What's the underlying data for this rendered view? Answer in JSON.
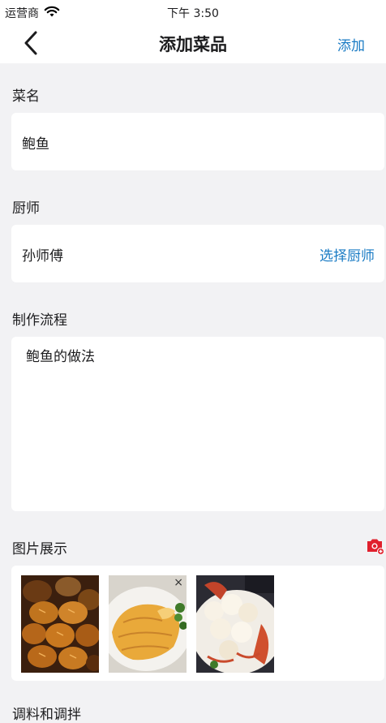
{
  "status_bar": {
    "carrier": "运营商",
    "time": "下午 3:50"
  },
  "nav": {
    "title": "添加菜品",
    "action": "添加"
  },
  "dish_name": {
    "label": "菜名",
    "value": "鲍鱼"
  },
  "chef": {
    "label": "厨师",
    "value": "孙师傅",
    "action": "选择厨师"
  },
  "process": {
    "label": "制作流程",
    "value": "鲍鱼的做法"
  },
  "gallery": {
    "label": "图片展示",
    "remove_symbol": "×",
    "photo_count": 3
  },
  "next_section": {
    "label": "调料和调拌"
  },
  "colors": {
    "accent": "#1a7bc4",
    "camera": "#e0202d",
    "background": "#f2f2f4"
  }
}
